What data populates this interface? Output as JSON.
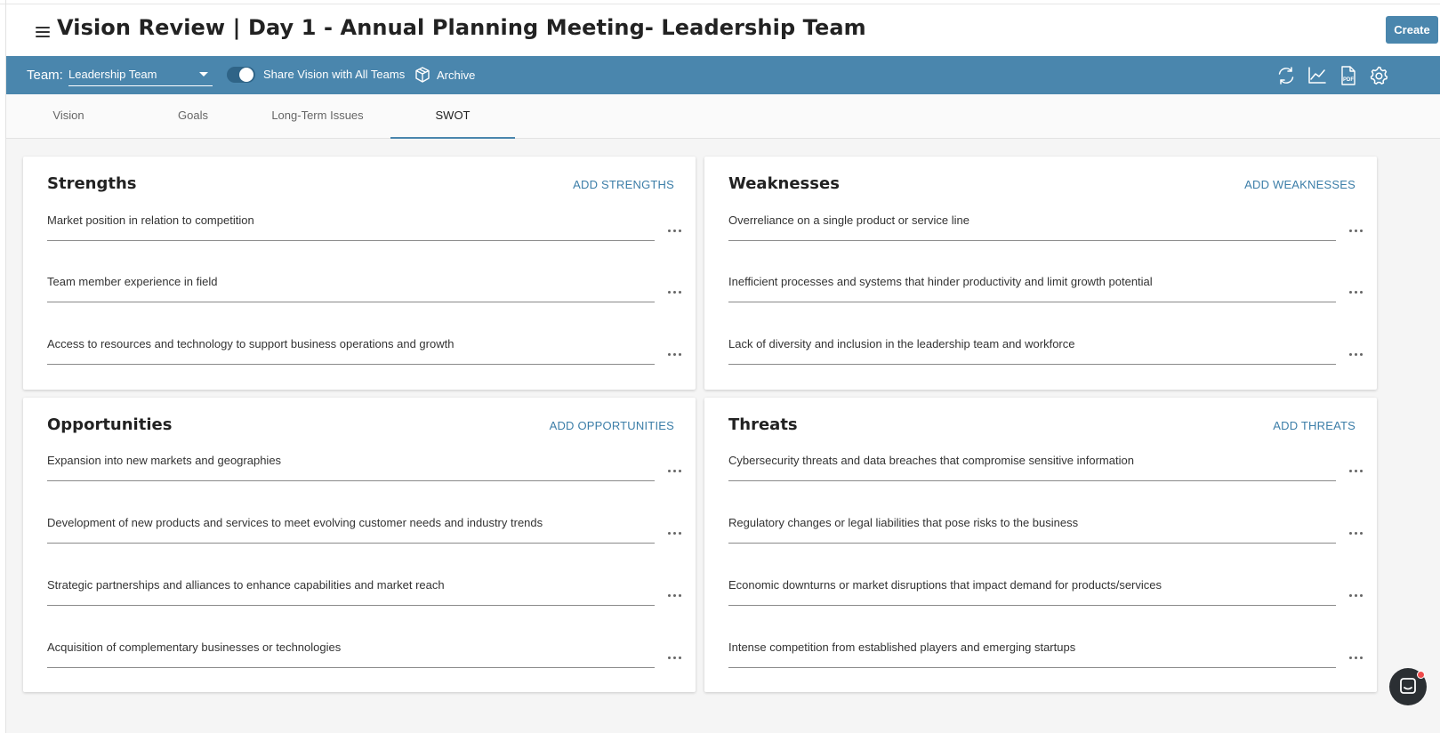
{
  "header": {
    "title": "Vision Review | Day 1 - Annual Planning Meeting- Leadership Team",
    "create_label": "Create"
  },
  "toolbar": {
    "team_label": "Team:",
    "team_value": "Leadership Team",
    "share_toggle_on": true,
    "share_label": "Share Vision with All Teams",
    "archive_label": "Archive",
    "icons": [
      "refresh-icon",
      "chart-icon",
      "pdf-icon",
      "settings-icon"
    ],
    "pdf_icon_text": "PDF"
  },
  "tabs": [
    {
      "label": "Vision",
      "active": false
    },
    {
      "label": "Goals",
      "active": false
    },
    {
      "label": "Long-Term Issues",
      "active": false
    },
    {
      "label": "SWOT",
      "active": true
    }
  ],
  "swot": {
    "strengths": {
      "title": "Strengths",
      "add_label": "ADD STRENGTHS",
      "items": [
        "Market position in relation to competition",
        "Team member experience in field",
        "Access to resources and technology to support business operations and growth"
      ]
    },
    "weaknesses": {
      "title": "Weaknesses",
      "add_label": "ADD WEAKNESSES",
      "items": [
        "Overreliance on a single product or service line",
        "Inefficient processes and systems that hinder productivity and limit growth potential",
        "Lack of diversity and inclusion in the leadership team and workforce"
      ]
    },
    "opportunities": {
      "title": "Opportunities",
      "add_label": "ADD OPPORTUNITIES",
      "items": [
        "Expansion into new markets and geographies",
        "Development of new products and services to meet evolving customer needs and industry trends",
        "Strategic partnerships and alliances to enhance capabilities and market reach",
        "Acquisition of complementary businesses or technologies"
      ]
    },
    "threats": {
      "title": "Threats",
      "add_label": "ADD THREATS",
      "items": [
        "Cybersecurity threats and data breaches that compromise sensitive information",
        "Regulatory changes or legal liabilities that pose risks to the business",
        "Economic downturns or market disruptions that impact demand for products/services",
        "Intense competition from established players and emerging startups"
      ]
    }
  },
  "colors": {
    "brand": "#4a86ad",
    "link": "#3c7ea8",
    "chat": "#2b2f33",
    "notification": "#ef4b4b"
  }
}
